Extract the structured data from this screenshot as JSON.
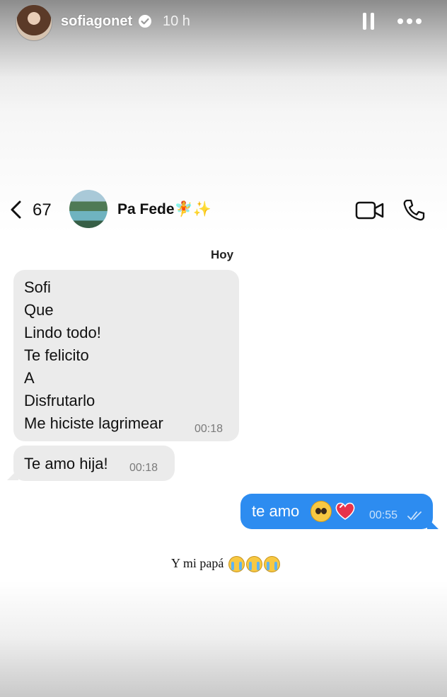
{
  "story": {
    "username": "sofiagonet",
    "time_ago": "10 h"
  },
  "chat": {
    "back_count": "67",
    "contact_name": "Pa Fede🧚✨",
    "date_label": "Hoy",
    "messages": [
      {
        "direction": "incoming",
        "lines": [
          "Sofi",
          "Que",
          "Lindo todo!",
          "Te felicito",
          "A",
          "Disfrutarlo",
          "Me hiciste lagrimear"
        ],
        "time": "00:18"
      },
      {
        "direction": "incoming",
        "lines": [
          "Te amo hija!"
        ],
        "time": "00:18"
      },
      {
        "direction": "outgoing",
        "text": "te amo",
        "emojis": [
          "pleading-face",
          "sparkling-heart"
        ],
        "time": "00:55",
        "status": "read"
      }
    ]
  },
  "caption": {
    "text": "Y mi papá",
    "emojis": [
      "crying-face",
      "crying-face",
      "crying-face"
    ]
  },
  "colors": {
    "outgoing_bubble": "#2d8cf0",
    "incoming_bubble": "#ebebeb"
  }
}
